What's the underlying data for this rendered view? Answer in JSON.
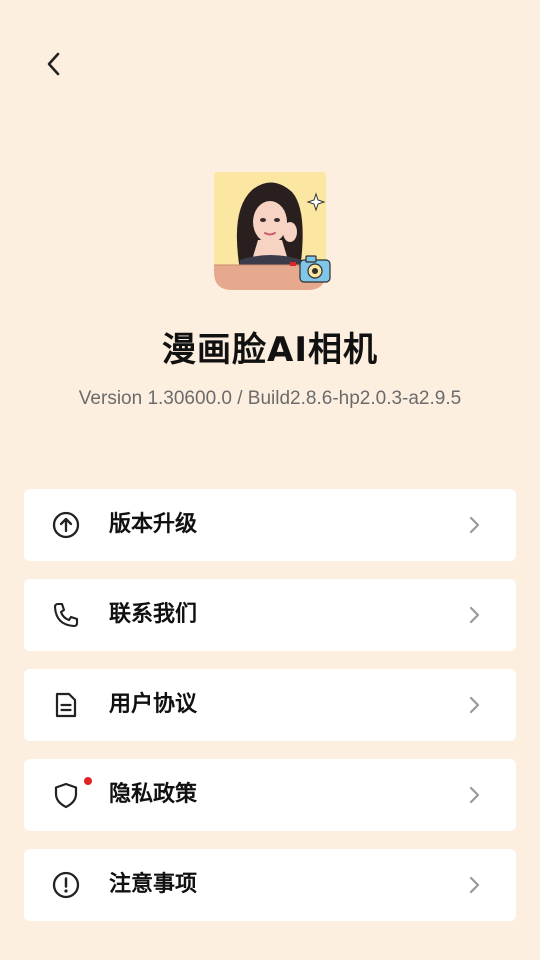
{
  "header": {
    "back_icon": "chevron-left-icon"
  },
  "app": {
    "name": "漫画脸AI相机",
    "version": "Version 1.30600.0 / Build2.8.6-hp2.0.3-a2.9.5"
  },
  "menu": [
    {
      "label": "版本升级",
      "icon": "upgrade-arrow-icon"
    },
    {
      "label": "联系我们",
      "icon": "phone-icon"
    },
    {
      "label": "用户协议",
      "icon": "document-icon"
    },
    {
      "label": "隐私政策",
      "icon": "shield-icon",
      "badge": "red-dot"
    },
    {
      "label": "注意事项",
      "icon": "alert-circle-icon"
    }
  ],
  "colors": {
    "background": "#FDEFE0",
    "card": "#FFFFFF",
    "text": "#111111",
    "secondary_text": "#6b6b6b",
    "badge": "#E02424"
  }
}
